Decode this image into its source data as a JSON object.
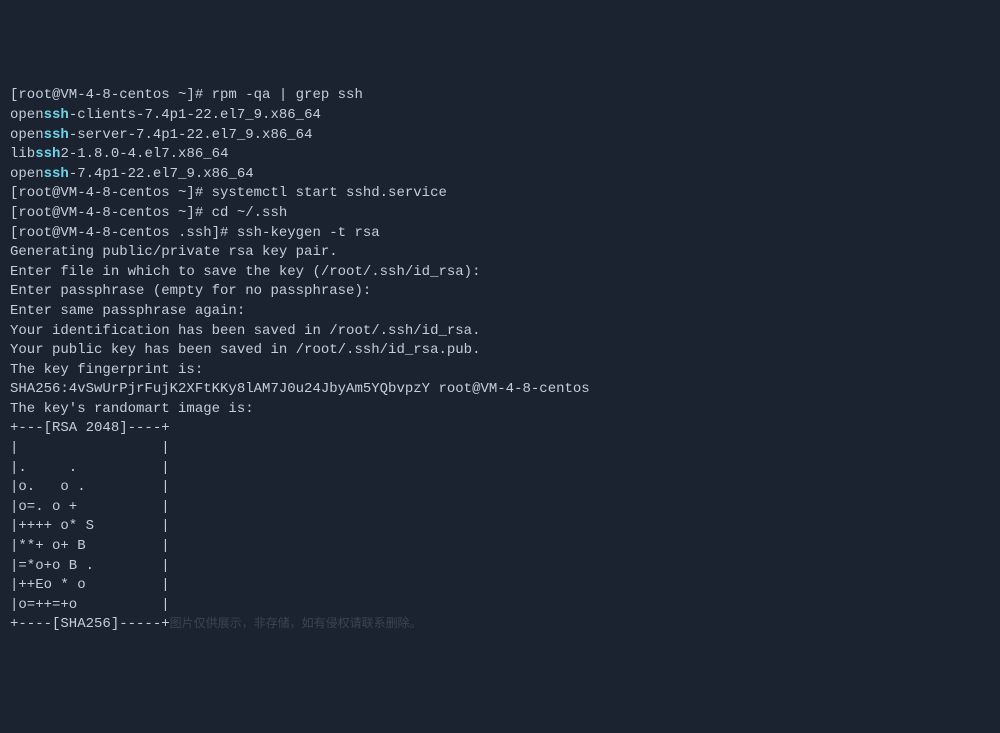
{
  "terminal": {
    "lines": [
      {
        "parts": [
          {
            "text": "[root@VM-4-8-centos ~]# rpm -qa | grep ssh",
            "hl": false
          }
        ]
      },
      {
        "parts": [
          {
            "text": "open",
            "hl": false
          },
          {
            "text": "ssh",
            "hl": true
          },
          {
            "text": "-clients-7.4p1-22.el7_9.x86_64",
            "hl": false
          }
        ]
      },
      {
        "parts": [
          {
            "text": "open",
            "hl": false
          },
          {
            "text": "ssh",
            "hl": true
          },
          {
            "text": "-server-7.4p1-22.el7_9.x86_64",
            "hl": false
          }
        ]
      },
      {
        "parts": [
          {
            "text": "lib",
            "hl": false
          },
          {
            "text": "ssh",
            "hl": true
          },
          {
            "text": "2-1.8.0-4.el7.x86_64",
            "hl": false
          }
        ]
      },
      {
        "parts": [
          {
            "text": "open",
            "hl": false
          },
          {
            "text": "ssh",
            "hl": true
          },
          {
            "text": "-7.4p1-22.el7_9.x86_64",
            "hl": false
          }
        ]
      },
      {
        "parts": [
          {
            "text": "[root@VM-4-8-centos ~]# systemctl start sshd.service",
            "hl": false
          }
        ]
      },
      {
        "parts": [
          {
            "text": "[root@VM-4-8-centos ~]# cd ~/.ssh",
            "hl": false
          }
        ]
      },
      {
        "parts": [
          {
            "text": "[root@VM-4-8-centos .ssh]# ssh-keygen -t rsa",
            "hl": false
          }
        ]
      },
      {
        "parts": [
          {
            "text": "Generating public/private rsa key pair.",
            "hl": false
          }
        ]
      },
      {
        "parts": [
          {
            "text": "Enter file in which to save the key (/root/.ssh/id_rsa):",
            "hl": false
          }
        ]
      },
      {
        "parts": [
          {
            "text": "Enter passphrase (empty for no passphrase):",
            "hl": false
          }
        ]
      },
      {
        "parts": [
          {
            "text": "Enter same passphrase again:",
            "hl": false
          }
        ]
      },
      {
        "parts": [
          {
            "text": "Your identification has been saved in /root/.ssh/id_rsa.",
            "hl": false
          }
        ]
      },
      {
        "parts": [
          {
            "text": "Your public key has been saved in /root/.ssh/id_rsa.pub.",
            "hl": false
          }
        ]
      },
      {
        "parts": [
          {
            "text": "The key fingerprint is:",
            "hl": false
          }
        ]
      },
      {
        "parts": [
          {
            "text": "SHA256:4vSwUrPjrFujK2XFtKKy8lAM7J0u24JbyAm5YQbvpzY root@VM-4-8-centos",
            "hl": false
          }
        ]
      },
      {
        "parts": [
          {
            "text": "The key's randomart image is:",
            "hl": false
          }
        ]
      },
      {
        "parts": [
          {
            "text": "+---[RSA 2048]----+",
            "hl": false
          }
        ]
      },
      {
        "parts": [
          {
            "text": "|                 |",
            "hl": false
          }
        ]
      },
      {
        "parts": [
          {
            "text": "|.     .          |",
            "hl": false
          }
        ]
      },
      {
        "parts": [
          {
            "text": "|o.   o .         |",
            "hl": false
          }
        ]
      },
      {
        "parts": [
          {
            "text": "|o=. o +          |",
            "hl": false
          }
        ]
      },
      {
        "parts": [
          {
            "text": "|++++ o* S        |",
            "hl": false
          }
        ]
      },
      {
        "parts": [
          {
            "text": "|**+ o+ B         |",
            "hl": false
          }
        ]
      },
      {
        "parts": [
          {
            "text": "|=*o+o B .        |",
            "hl": false
          }
        ]
      },
      {
        "parts": [
          {
            "text": "|++Eo * o         |",
            "hl": false
          }
        ]
      },
      {
        "parts": [
          {
            "text": "|o=++=+o          |",
            "hl": false
          }
        ]
      },
      {
        "parts": [
          {
            "text": "+----[SHA256]-----+",
            "hl": false
          }
        ]
      }
    ],
    "watermark": "图片仅供展示，非存储，如有侵权请联系删除。"
  }
}
